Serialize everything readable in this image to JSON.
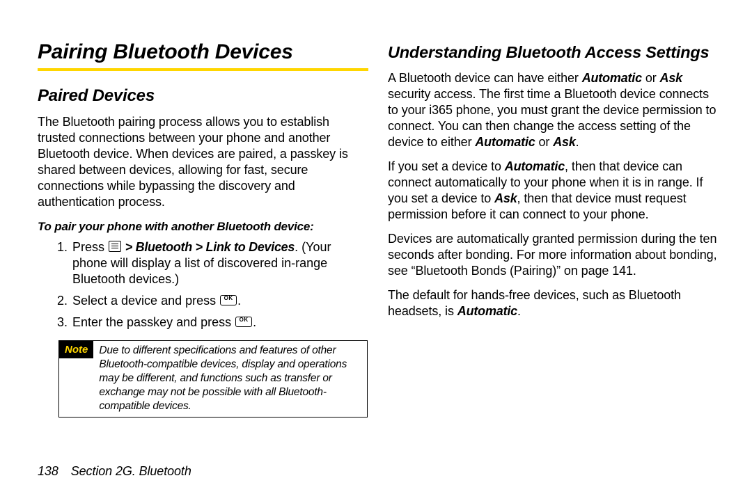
{
  "left": {
    "h1": "Pairing Bluetooth Devices",
    "h2": "Paired Devices",
    "para1": "The Bluetooth pairing process allows you to establish trusted connections between your phone and another Bluetooth device. When devices are paired, a passkey is shared between devices, allowing for fast, secure connections while bypassing the discovery and authentication process.",
    "instr": "To pair your phone with another Bluetooth device:",
    "step1_a": "Press ",
    "step1_b": " > ",
    "step1_bt": "Bluetooth",
    "step1_gt": " > ",
    "step1_link": "Link to Devices",
    "step1_c": ". (Your phone will display a list of discovered in-range Bluetooth devices.)",
    "step2_a": "Select a device and press ",
    "step2_b": ".",
    "step3_a": "Enter the passkey and press ",
    "step3_b": ".",
    "note_label": "Note",
    "note_body": "Due to different specifications and features of other Bluetooth-compatible devices, display and operations may be different, and functions such as transfer or exchange may not be possible with all Bluetooth-compatible devices."
  },
  "right": {
    "h2": "Understanding Bluetooth Access Settings",
    "p1_a": "A Bluetooth device can have either ",
    "p1_auto": "Automatic",
    "p1_b": " or ",
    "p1_ask": "Ask",
    "p1_c": " security access. The first time a Bluetooth device connects to your i365 phone, you must grant the device permission to connect. You can then change the access setting of the device to either ",
    "p1_auto2": "Automatic",
    "p1_d": " or ",
    "p1_ask2": "Ask",
    "p1_e": ".",
    "p2_a": "If you set a device to ",
    "p2_auto": "Automatic",
    "p2_b": ", then that device can connect automatically to your phone when it is in range. If you set a device to ",
    "p2_ask": "Ask",
    "p2_c": ", then that device must request permission before it can connect to your phone.",
    "p3": "Devices are automatically granted permission during the ten seconds after bonding. For more information about bonding, see “Bluetooth Bonds (Pairing)” on page 141.",
    "p4_a": "The default for hands-free devices, such as Bluetooth headsets, is ",
    "p4_auto": "Automatic",
    "p4_b": "."
  },
  "footer": {
    "page": "138",
    "section": "Section 2G. Bluetooth"
  }
}
